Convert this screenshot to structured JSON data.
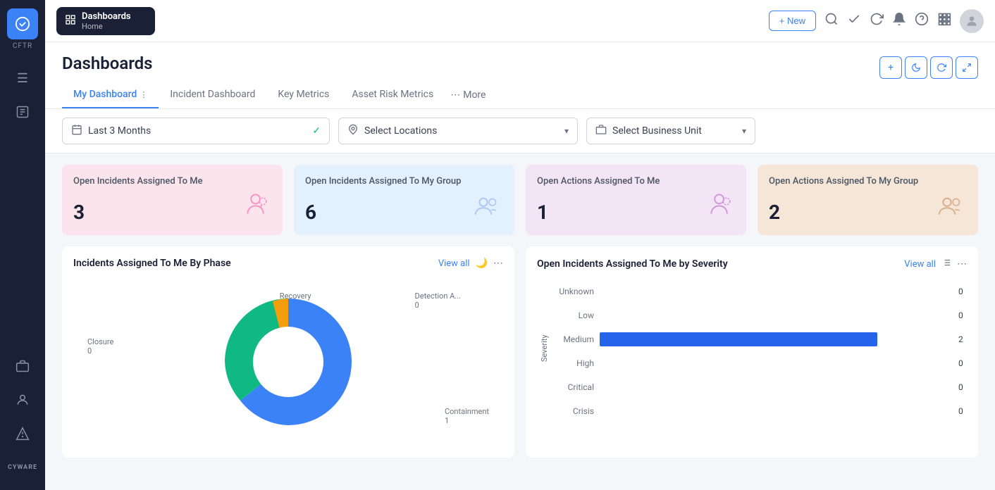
{
  "app": {
    "name": "CFTR",
    "topbar_app": "Dashboards",
    "topbar_subtitle": "Home",
    "new_button": "+ New"
  },
  "tabs": [
    {
      "label": "My Dashboard",
      "active": true
    },
    {
      "label": "Incident Dashboard",
      "active": false
    },
    {
      "label": "Key Metrics",
      "active": false
    },
    {
      "label": "Asset Risk Metrics",
      "active": false
    },
    {
      "label": "More",
      "active": false
    }
  ],
  "filters": {
    "date_range": "Last 3 Months",
    "location_placeholder": "Select Locations",
    "business_unit_placeholder": "Select Business Unit"
  },
  "kpi_cards": [
    {
      "title": "Open Incidents Assigned To Me",
      "value": "3",
      "color": "pink",
      "icon": "👤"
    },
    {
      "title": "Open Incidents Assigned To My Group",
      "value": "6",
      "color": "blue",
      "icon": "👥"
    },
    {
      "title": "Open Actions Assigned To Me",
      "value": "1",
      "color": "purple",
      "icon": "👤"
    },
    {
      "title": "Open Actions Assigned To My Group",
      "value": "2",
      "color": "tan",
      "icon": "👥"
    }
  ],
  "donut_chart": {
    "title": "Incidents Assigned To Me By Phase",
    "view_all": "View all",
    "segments": [
      {
        "label": "Recovery",
        "value": 0,
        "color": "#f59e0b"
      },
      {
        "label": "Detection A...",
        "value": 0,
        "color": "#10b981"
      },
      {
        "label": "Closure",
        "value": 0,
        "color": "#3b82f6"
      },
      {
        "label": "Containment",
        "value": 1,
        "color": "#3b82f6"
      }
    ]
  },
  "bar_chart": {
    "title": "Open Incidents Assigned To Me by Severity",
    "view_all": "View all",
    "y_axis_label": "Severity",
    "bars": [
      {
        "label": "Unknown",
        "value": 0,
        "width_pct": 0
      },
      {
        "label": "Low",
        "value": 0,
        "width_pct": 0
      },
      {
        "label": "Medium",
        "value": 2,
        "width_pct": 80
      },
      {
        "label": "High",
        "value": 0,
        "width_pct": 0
      },
      {
        "label": "Critical",
        "value": 0,
        "width_pct": 0
      },
      {
        "label": "Crisis",
        "value": 0,
        "width_pct": 0
      }
    ]
  }
}
